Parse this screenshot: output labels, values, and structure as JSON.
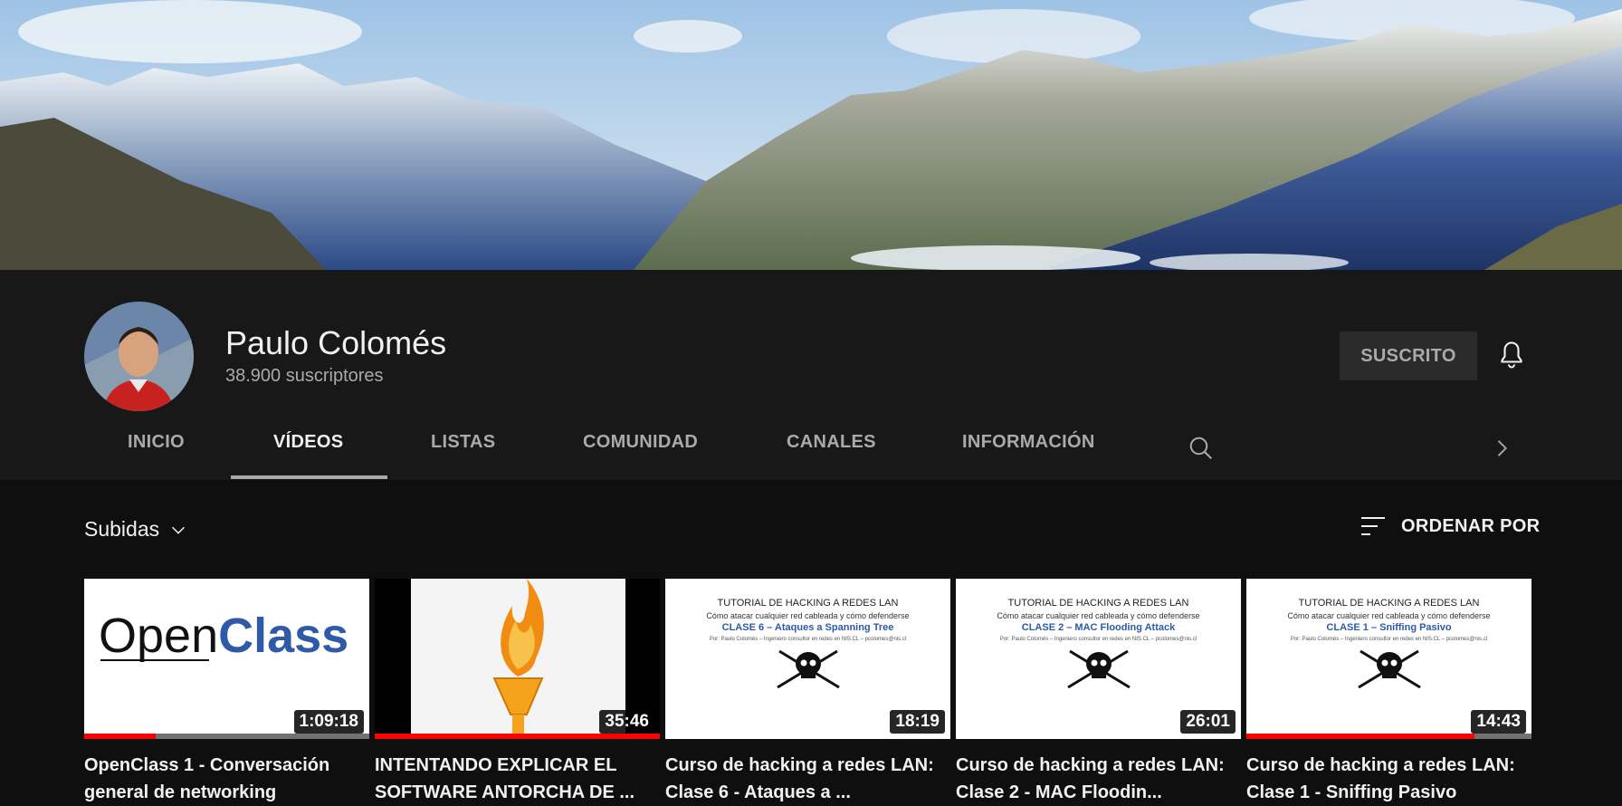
{
  "channel": {
    "name": "Paulo Colomés",
    "subscribers": "38.900 suscriptores",
    "subscribe_label": "SUSCRITO"
  },
  "tabs": [
    {
      "label": "INICIO",
      "active": false
    },
    {
      "label": "VÍDEOS",
      "active": true
    },
    {
      "label": "LISTAS",
      "active": false
    },
    {
      "label": "COMUNIDAD",
      "active": false
    },
    {
      "label": "CANALES",
      "active": false
    },
    {
      "label": "INFORMACIÓN",
      "active": false
    }
  ],
  "toolbar": {
    "filter_label": "Subidas",
    "sort_label": "ORDENAR POR"
  },
  "videos": [
    {
      "title": "OpenClass 1 - Conversación general de networking",
      "duration": "1:09:18",
      "progress": 0.25,
      "thumb": {
        "open": "Open",
        "class": "Class"
      }
    },
    {
      "title": "INTENTANDO EXPLICAR EL SOFTWARE ANTORCHA DE ...",
      "duration": "35:46",
      "progress": 1.0
    },
    {
      "title": "Curso de hacking a redes LAN: Clase 6 - Ataques a ...",
      "duration": "18:19",
      "progress": 0,
      "thumb": {
        "heading": "TUTORIAL DE HACKING A REDES LAN",
        "sub": "Cómo atacar cualquier red cableada y cómo defenderse",
        "clase": "CLASE 6 – Ataques a Spanning Tree",
        "author": "Por: Paulo Colomés – Ingeniero consultor en redes en NIS.CL – pcolomes@nis.cl"
      }
    },
    {
      "title": "Curso de hacking a redes LAN: Clase 2 - MAC Floodin...",
      "duration": "26:01",
      "progress": 0,
      "thumb": {
        "heading": "TUTORIAL DE HACKING A REDES LAN",
        "sub": "Cómo atacar cualquier red cableada y cómo defenderse",
        "clase": "CLASE 2 – MAC Flooding Attack",
        "author": "Por: Paulo Colomés – Ingeniero consultor en redes en NIS.CL – pcolomes@nis.cl"
      }
    },
    {
      "title": "Curso de hacking a redes LAN: Clase 1 - Sniffing Pasivo",
      "duration": "14:43",
      "progress": 0.8,
      "thumb": {
        "heading": "TUTORIAL DE HACKING A REDES LAN",
        "sub": "Cómo atacar cualquier red cableada y cómo defenderse",
        "clase": "CLASE 1 – Sniffing Pasivo",
        "author": "Por: Paulo Colomés – Ingeniero consultor en redes en NIS.CL – pcolomes@nis.cl"
      }
    }
  ],
  "colors": {
    "background": "#0f0f0f",
    "header": "#181818",
    "progress": "#ff0000",
    "clase_blue": "#2e5aa8"
  }
}
